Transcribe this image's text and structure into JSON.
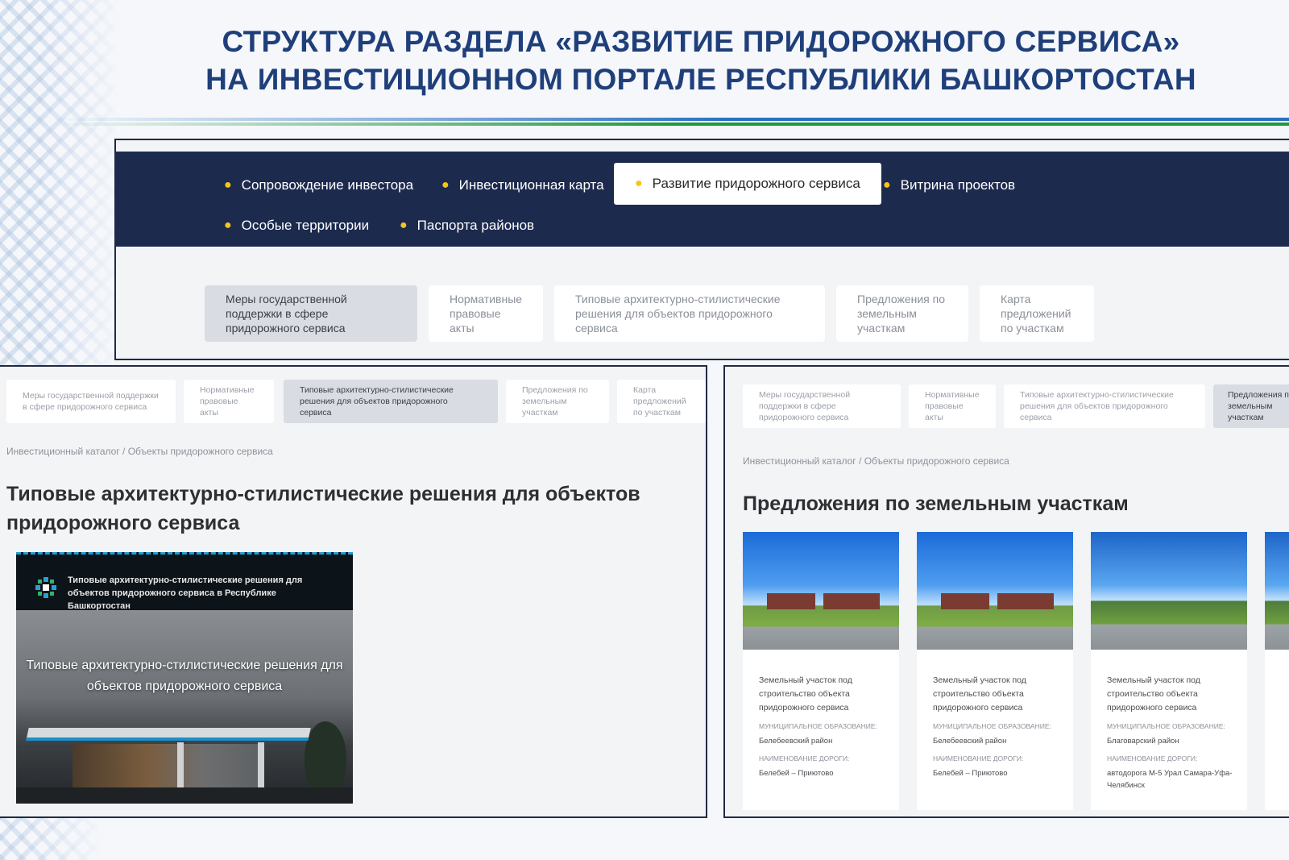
{
  "slide": {
    "title_line1": "СТРУКТУРА РАЗДЕЛА «РАЗВИТИЕ ПРИДОРОЖНОГО СЕРВИСА»",
    "title_line2": "НА ИНВЕСТИЦИОННОМ ПОРТАЛЕ РЕСПУБЛИКИ БАШКОРТОСТАН",
    "colors": {
      "title": "#1f3f7a",
      "stripe_blue": "#2a6fc0",
      "stripe_green": "#1f9a3d",
      "nav_bg": "#1c2a4e",
      "nav_dot": "#f5c518"
    }
  },
  "nav": {
    "items": [
      "Сопровождение инвестора",
      "Инвестиционная карта",
      "Развитие придорожного сервиса",
      "Витрина проектов",
      "Особые территории",
      "Паспорта районов"
    ],
    "active": "Развитие придорожного сервиса"
  },
  "subtabs": [
    "Меры государственной поддержки в сфере придорожного сервиса",
    "Нормативные правовые акты",
    "Типовые архитектурно-стилистические решения для объектов придорожного сервиса",
    "Предложения по земельным участкам",
    "Карта предложений по участкам"
  ],
  "subtabs_right_partial": {
    "last": "Предложения по земельным участкам"
  },
  "breadcrumb": {
    "root": "Инвестиционный каталог",
    "separator": "/",
    "current": "Объекты придорожного сервиса"
  },
  "left_page": {
    "heading": "Типовые архитектурно-стилистические решения для объектов придорожного сервиса",
    "banner": {
      "header_text": "Типовые архитектурно-стилистические решения для объектов придорожного сервиса в Республике Башкортостан",
      "title": "Типовые архитектурно-стилистические решения для объектов придорожного сервиса"
    }
  },
  "right_page": {
    "heading": "Предложения по земельным участкам",
    "cards": [
      {
        "title": "Земельный участок под строительство объекта придорожного сервиса",
        "municipality_label": "Муниципальное образование:",
        "municipality": "Белебеевский район",
        "road_label": "Наименование дороги:",
        "road": "Белебей – Приютово"
      },
      {
        "title": "Земельный участок под строительство объекта придорожного сервиса",
        "municipality_label": "Муниципальное образование:",
        "municipality": "Белебеевский район",
        "road_label": "Наименование дороги:",
        "road": "Белебей – Приютово"
      },
      {
        "title": "Земельный участок под строительство объекта придорожного сервиса",
        "municipality_label": "Муниципальное образование:",
        "municipality": "Благоварский район",
        "road_label": "Наименование дороги:",
        "road": "автодорога М-5 Урал Самара-Уфа-Челябинск"
      }
    ]
  }
}
